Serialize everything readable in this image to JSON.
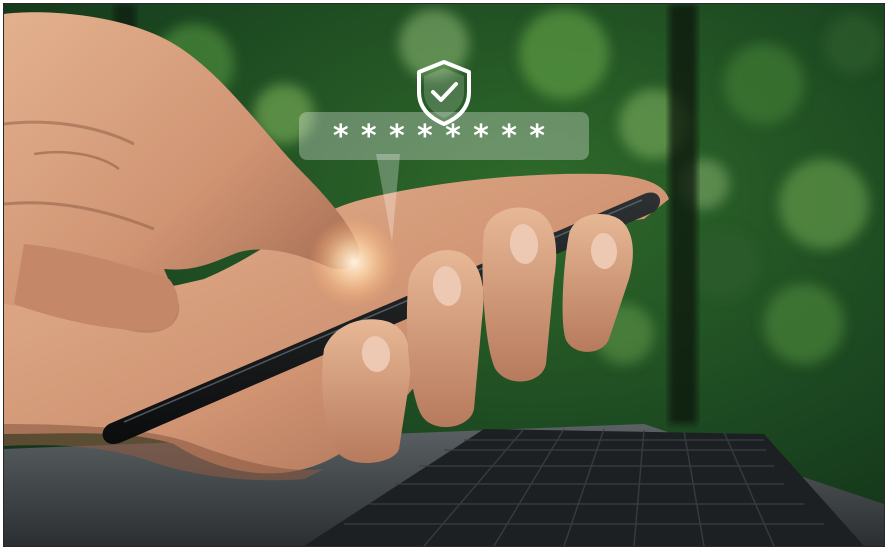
{
  "overlay": {
    "password_mask": "********",
    "mask_char": "*",
    "icon": "shield-check-icon"
  },
  "colors": {
    "foliage_dark": "#0f2a14",
    "foliage_mid": "#2f6a2a",
    "foliage_light": "#8bbd6a",
    "skin": "#d9a27f",
    "skin_shadow": "#a86c4e",
    "phone": "#121415",
    "laptop": "#4a4f52",
    "keys": "#1c2022",
    "overlay_glass": "#ffffff",
    "glow": "#ffd8a8"
  }
}
